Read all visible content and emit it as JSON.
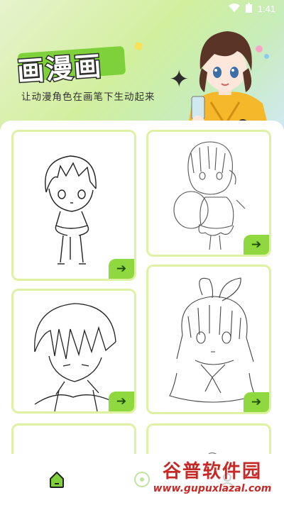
{
  "status_bar": {
    "time": "1:41"
  },
  "header": {
    "logo_text": "画漫画",
    "tagline": "让动漫角色在画笔下生动起来"
  },
  "cards": [
    {
      "name": "chibi-boy",
      "action": "➔"
    },
    {
      "name": "chibi-girl",
      "action": "➔"
    },
    {
      "name": "boy-portrait",
      "action": "➔"
    },
    {
      "name": "girl-bow",
      "action": "➔"
    },
    {
      "name": "partial-left",
      "action": ""
    },
    {
      "name": "partial-right",
      "action": ""
    }
  ],
  "nav": {
    "items": [
      {
        "name": "home-icon"
      },
      {
        "name": "explore-icon"
      },
      {
        "name": "profile-icon"
      }
    ]
  },
  "watermark": {
    "title": "谷普软件园",
    "url": "www.gupuxlazal.com"
  },
  "colors": {
    "accent": "#8fd83f",
    "card_border": "#dff1a3",
    "header_gradient_start": "#e7f3ce",
    "header_gradient_end": "#cfe9f3",
    "watermark": "#c52a26"
  }
}
